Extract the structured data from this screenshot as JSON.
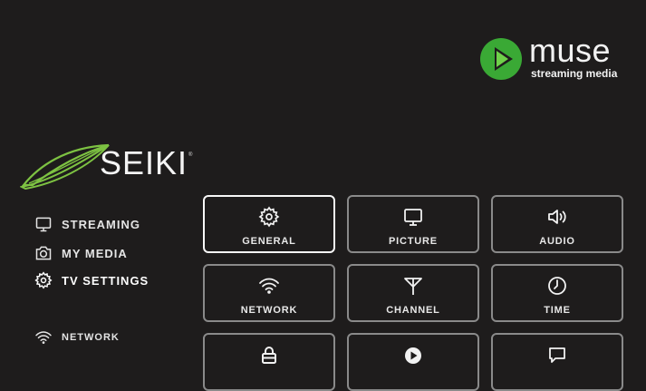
{
  "branding": {
    "muse_word": "muse",
    "muse_sub": "streaming media",
    "seiki_word": "SEIKI",
    "seiki_reg": "®",
    "muse_green": "#3aa935",
    "seiki_green": "#7dc242"
  },
  "sidebar": {
    "items": [
      {
        "label": "STREAMING",
        "icon": "tv-icon"
      },
      {
        "label": "MY MEDIA",
        "icon": "camera-icon"
      },
      {
        "label": "TV SETTINGS",
        "icon": "gear-icon",
        "active": true
      }
    ],
    "network": {
      "label": "NETWORK",
      "icon": "wifi-icon"
    }
  },
  "tiles": [
    {
      "label": "GENERAL",
      "icon": "gear-icon",
      "selected": true
    },
    {
      "label": "PICTURE",
      "icon": "monitor-icon"
    },
    {
      "label": "AUDIO",
      "icon": "speaker-icon"
    },
    {
      "label": "NETWORK",
      "icon": "wifi-icon"
    },
    {
      "label": "CHANNEL",
      "icon": "antenna-icon"
    },
    {
      "label": "TIME",
      "icon": "clock-icon"
    },
    {
      "label": "",
      "icon": "lock-icon"
    },
    {
      "label": "",
      "icon": "play-logo-icon"
    },
    {
      "label": "",
      "icon": "chat-icon"
    }
  ]
}
